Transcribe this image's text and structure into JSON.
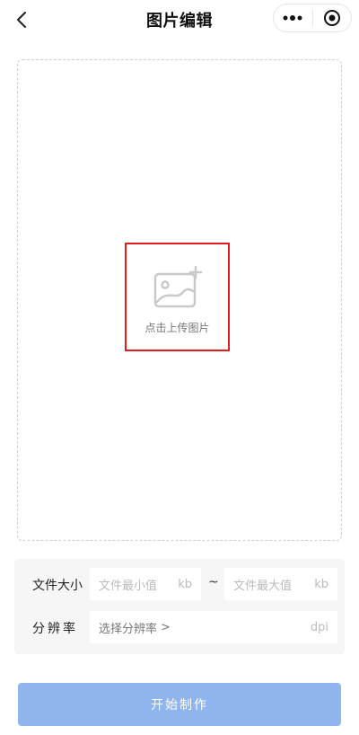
{
  "header": {
    "title": "图片编辑"
  },
  "upload": {
    "label": "点击上传图片"
  },
  "form": {
    "file_size_label": "文件大小",
    "min_placeholder": "文件最小值",
    "max_placeholder": "文件最大值",
    "size_unit": "kb",
    "range_separator": "~",
    "resolution_label": "分辨率",
    "resolution_placeholder": "选择分辨率",
    "resolution_chevron": ">",
    "resolution_unit": "dpi"
  },
  "actions": {
    "start_label": "开始制作"
  },
  "colors": {
    "accent": "#8fb4ee",
    "highlight": "#e21d1d"
  },
  "icons": [
    "back-arrow-icon",
    "more-dots-icon",
    "target-circle-icon",
    "image-add-icon"
  ]
}
